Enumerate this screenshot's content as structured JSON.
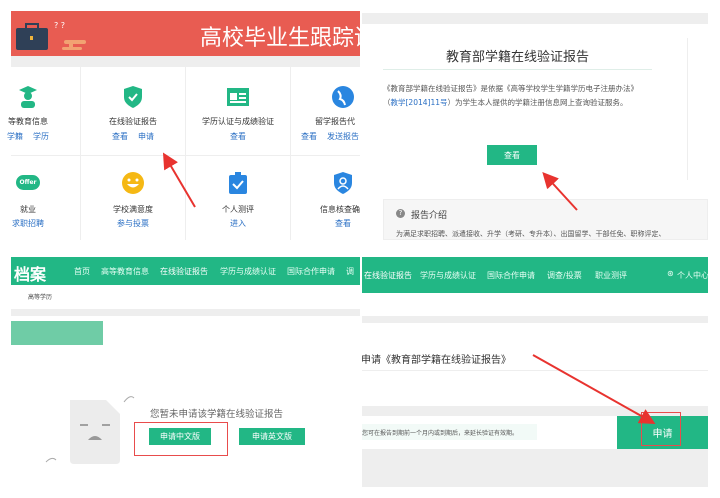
{
  "panel1": {
    "banner_title": "高校毕业生跟踪调",
    "services": [
      {
        "label": "等教育信息",
        "links": [
          "学籍",
          "学历"
        ]
      },
      {
        "label": "在线验证报告",
        "links": [
          "查看",
          "申请"
        ]
      },
      {
        "label": "学历认证与成绩验证",
        "links": [
          "查看"
        ]
      },
      {
        "label": "留学报告代",
        "links": [
          "查看",
          "发送报告"
        ]
      },
      {
        "label": "就业",
        "links": [
          "求职招聘"
        ],
        "icon_text": "Offer"
      },
      {
        "label": "学校满意度",
        "links": [
          "参与投票"
        ]
      },
      {
        "label": "个人测评",
        "links": [
          "进入"
        ]
      },
      {
        "label": "信息核查确",
        "links": [
          "查看"
        ]
      }
    ]
  },
  "panel2": {
    "title": "教育部学籍在线验证报告",
    "desc_part1": "《教育部学籍在线验证报告》是依据《高等学校学生学籍学历电子注册办法》（",
    "desc_link": "教学[2014]11号",
    "desc_part2": "）为学生本人提供的学籍注册信息网上查询验证服务。",
    "view_button": "查看",
    "intro_title": "报告介绍",
    "intro_text": "为满足求职招聘、派遣接收、升学（考研、专升本）、出国留学、干部任免、职称评定、"
  },
  "panel3": {
    "logo": "档案",
    "nav": [
      "首页",
      "高等教育信息",
      "在线验证报告",
      "学历与成绩认证",
      "国际合作申请",
      "调"
    ],
    "breadcrumb": "高等学历",
    "empty_message": "您暂未申请该学籍在线验证报告",
    "apply_cn": "申请中文版",
    "apply_en": "申请英文版"
  },
  "panel4": {
    "nav": [
      "在线验证报告",
      "学历与成绩认证",
      "国际合作申请",
      "调查/投票",
      "职业测评"
    ],
    "user_menu": "个人中心",
    "title": "申请《教育部学籍在线验证报告》",
    "notice": "您可在报告到期前一个月内或到期后，来延长验证有效期。",
    "apply_button": "申请"
  },
  "colors": {
    "green": "#22b785",
    "red": "#e85c52",
    "link": "#2a6fc4"
  }
}
